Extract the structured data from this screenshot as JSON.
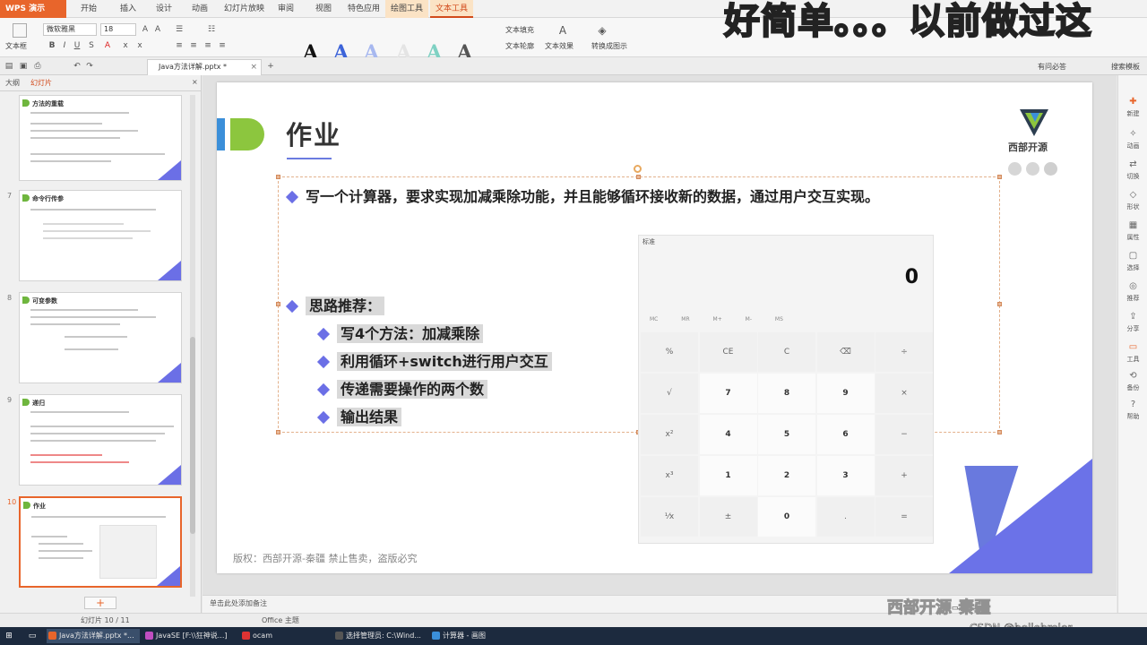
{
  "app": {
    "name": "WPS 演示",
    "menu_tabs": [
      "开始",
      "插入",
      "设计",
      "动画",
      "幻灯片放映",
      "审阅",
      "视图",
      "特色应用",
      "绘图工具",
      "文本工具"
    ],
    "active_tab": "文本工具"
  },
  "ribbon": {
    "textbox_label": "文本框",
    "font_name": "微软雅黑",
    "font_size": "18",
    "text_fill": "文本填充",
    "text_outline": "文本轮廓",
    "text_effect": "文本效果",
    "convert_smartart": "转换成图示",
    "style_letters": [
      "A",
      "A",
      "A",
      "A",
      "A",
      "A"
    ]
  },
  "overlay_caption": "好简单。。。以前做过这",
  "tabs": {
    "doc_tab": "Java方法详解.pptx *",
    "right_links": [
      "有问必答",
      "搜索模板"
    ]
  },
  "left_panel": {
    "tab_outline": "大纲",
    "tab_slides": "幻灯片",
    "thumbs": [
      {
        "num": "",
        "title": "方法的重载"
      },
      {
        "num": "7",
        "title": "命令行传参"
      },
      {
        "num": "8",
        "title": "可变参数"
      },
      {
        "num": "9",
        "title": "递归"
      },
      {
        "num": "10",
        "title": "作业"
      }
    ],
    "add_label": "+"
  },
  "slide": {
    "title": "作业",
    "logo_text": "西部开源",
    "bullet_main": "写一个计算器，要求实现加减乘除功能，并且能够循环接收新的数据，通过用户交互实现。",
    "bullet_thoughts": "思路推荐：",
    "sub_bullets": [
      "写4个方法：加减乘除",
      "利用循环+switch进行用户交互",
      "传递需要操作的两个数",
      "输出结果"
    ],
    "copyright": "版权：西部开源-秦疆     禁止售卖，盗版必究"
  },
  "calculator": {
    "title": "标准",
    "display": "0",
    "memory_row": "MC MR M+ M- MS",
    "keys": [
      [
        "%",
        "CE",
        "C",
        "⌫",
        "÷"
      ],
      [
        "√",
        "7",
        "8",
        "9",
        "×"
      ],
      [
        "x²",
        "4",
        "5",
        "6",
        "−"
      ],
      [
        "x³",
        "1",
        "2",
        "3",
        "+"
      ],
      [
        "⅟x",
        "±",
        "0",
        ".",
        "="
      ]
    ]
  },
  "right_bar": [
    "新建",
    "动画",
    "切换",
    "形状",
    "属性",
    "选择",
    "推荐",
    "分享",
    "工具",
    "备份",
    "帮助"
  ],
  "notes_placeholder": "单击此处添加备注",
  "status": {
    "slide_pos": "幻灯片 10 / 11",
    "theme": "Office 主题"
  },
  "watermarks": {
    "brand": "西部开源-秦疆",
    "csdn": "CSDN @hellobroler"
  },
  "taskbar": [
    {
      "label": "Java方法详解.pptx *..."
    },
    {
      "label": "JavaSE [F:\\\\狂神说...]"
    },
    {
      "label": "ocam"
    },
    {
      "label": "选择管理员: C:\\Wind..."
    },
    {
      "label": "计算器 - 画图"
    }
  ],
  "colors": {
    "accent": "#e8652b",
    "bullet": "#6b6fe6",
    "title_green": "#8cc63e",
    "title_blue": "#3b8fd9"
  }
}
